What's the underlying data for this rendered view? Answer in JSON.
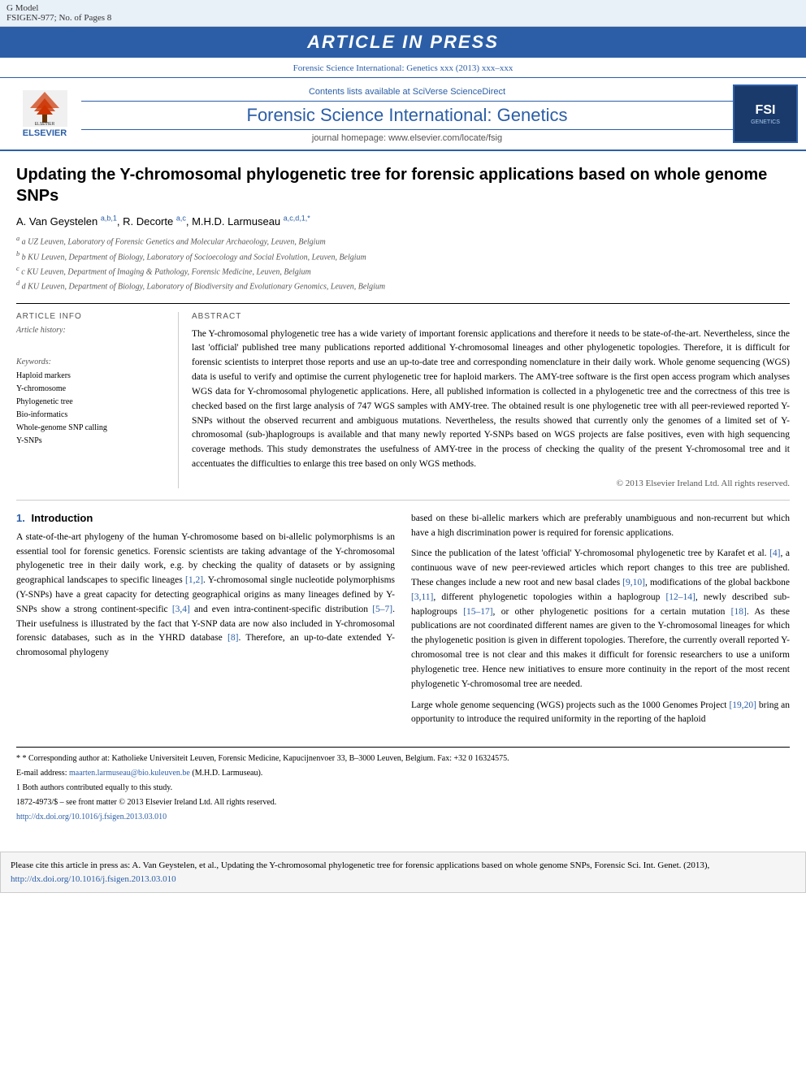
{
  "topBanner": {
    "leftText": "G Model\nFSIGEN-977; No. of Pages 8",
    "centerText": "ARTICLE IN PRESS"
  },
  "journalHeader": {
    "sciverse": "Contents lists available at SciVerse ScienceDirect",
    "title": "Forensic Science International: Genetics",
    "homepage": "journal homepage: www.elsevier.com/locate/fsig",
    "refLine": "Forensic Science International: Genetics xxx (2013) xxx–xxx"
  },
  "article": {
    "title": "Updating the Y-chromosomal phylogenetic tree for forensic applications based on whole genome SNPs",
    "authors": "A. Van Geystelen a,b,1, R. Decorte a,c, M.H.D. Larmuseau a,c,d,1,*",
    "affiliations": [
      "a UZ Leuven, Laboratory of Forensic Genetics and Molecular Archaeology, Leuven, Belgium",
      "b KU Leuven, Department of Biology, Laboratory of Socioecology and Social Evolution, Leuven, Belgium",
      "c KU Leuven, Department of Imaging & Pathology, Forensic Medicine, Leuven, Belgium",
      "d KU Leuven, Department of Biology, Laboratory of Biodiversity and Evolutionary Genomics, Leuven, Belgium"
    ]
  },
  "articleInfo": {
    "sectionTitle": "ARTICLE INFO",
    "historyLabel": "Article history:",
    "keywordsLabel": "Keywords:",
    "keywords": [
      "Haploid markers",
      "Y-chromosome",
      "Phylogenetic tree",
      "Bio-informatics",
      "Whole-genome SNP calling",
      "Y-SNPs"
    ]
  },
  "abstract": {
    "sectionTitle": "ABSTRACT",
    "text": "The Y-chromosomal phylogenetic tree has a wide variety of important forensic applications and therefore it needs to be state-of-the-art. Nevertheless, since the last 'official' published tree many publications reported additional Y-chromosomal lineages and other phylogenetic topologies. Therefore, it is difficult for forensic scientists to interpret those reports and use an up-to-date tree and corresponding nomenclature in their daily work. Whole genome sequencing (WGS) data is useful to verify and optimise the current phylogenetic tree for haploid markers. The AMY-tree software is the first open access program which analyses WGS data for Y-chromosomal phylogenetic applications. Here, all published information is collected in a phylogenetic tree and the correctness of this tree is checked based on the first large analysis of 747 WGS samples with AMY-tree. The obtained result is one phylogenetic tree with all peer-reviewed reported Y-SNPs without the observed recurrent and ambiguous mutations. Nevertheless, the results showed that currently only the genomes of a limited set of Y-chromosomal (sub-)haplogroups is available and that many newly reported Y-SNPs based on WGS projects are false positives, even with high sequencing coverage methods. This study demonstrates the usefulness of AMY-tree in the process of checking the quality of the present Y-chromosomal tree and it accentuates the difficulties to enlarge this tree based on only WGS methods.",
    "copyright": "© 2013 Elsevier Ireland Ltd. All rights reserved."
  },
  "introduction": {
    "sectionNum": "1.",
    "sectionTitle": "Introduction",
    "paragraphs": [
      "A state-of-the-art phylogeny of the human Y-chromosome based on bi-allelic polymorphisms is an essential tool for forensic genetics. Forensic scientists are taking advantage of the Y-chromosomal phylogenetic tree in their daily work, e.g. by checking the quality of datasets or by assigning geographical landscapes to specific lineages [1,2]. Y-chromosomal single nucleotide polymorphisms (Y-SNPs) have a great capacity for detecting geographical origins as many lineages defined by Y-SNPs show a strong continent-specific [3,4] and even intra-continent-specific distribution [5–7]. Their usefulness is illustrated by the fact that Y-SNP data are now also included in Y-chromosomal forensic databases, such as in the YHRD database [8]. Therefore, an up-to-date extended Y-chromosomal phylogeny"
    ],
    "rightParagraphs": [
      "based on these bi-allelic markers which are preferably unambiguous and non-recurrent but which have a high discrimination power is required for forensic applications.",
      "Since the publication of the latest 'official' Y-chromosomal phylogenetic tree by Karafet et al. [4], a continuous wave of new peer-reviewed articles which report changes to this tree are published. These changes include a new root and new basal clades [9,10], modifications of the global backbone [3,11], different phylogenetic topologies within a haplogroup [12–14], newly described sub-haplogroups [15–17], or other phylogenetic positions for a certain mutation [18]. As these publications are not coordinated different names are given to the Y-chromosomal lineages for which the phylogenetic position is given in different topologies. Therefore, the currently overall reported Y-chromosomal tree is not clear and this makes it difficult for forensic researchers to use a uniform phylogenetic tree. Hence new initiatives to ensure more continuity in the report of the most recent phylogenetic Y-chromosomal tree are needed.",
      "Large whole genome sequencing (WGS) projects such as the 1000 Genomes Project [19,20] bring an opportunity to introduce the required uniformity in the reporting of the haploid"
    ]
  },
  "footnotes": {
    "correspondingAuthor": "* Corresponding author at: Katholieke Universiteit Leuven, Forensic Medicine, Kapucijnenvoer 33, B–3000 Leuven, Belgium. Fax: +32 0 16324575.",
    "email": "E-mail address: maarten.larmuseau@bio.kuleuven.be (M.H.D. Larmuseau).",
    "equalContrib": "1 Both authors contributed equally to this study.",
    "issn": "1872-4973/$ – see front matter © 2013 Elsevier Ireland Ltd. All rights reserved.",
    "doi": "http://dx.doi.org/10.1016/j.fsigen.2013.03.010"
  },
  "bottomCitation": {
    "text": "Please cite this article in press as: A. Van Geystelen, et al., Updating the Y-chromosomal phylogenetic tree for forensic applications based on whole genome SNPs, Forensic Sci. Int. Genet. (2013),",
    "doiLink": "http://dx.doi.org/10.1016/j.fsigen.2013.03.010"
  }
}
